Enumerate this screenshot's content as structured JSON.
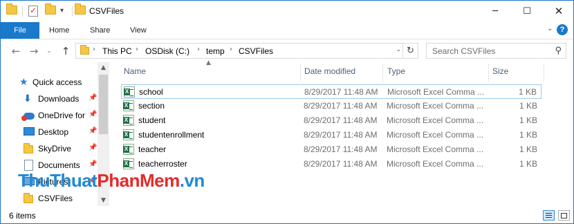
{
  "window": {
    "title": "CSVFiles"
  },
  "ribbon": {
    "tabs": [
      "File",
      "Home",
      "Share",
      "View"
    ]
  },
  "address": {
    "crumbs": [
      "This PC",
      "OSDisk (C:)",
      "temp",
      "CSVFiles"
    ]
  },
  "search": {
    "placeholder": "Search CSVFiles"
  },
  "nav": {
    "items": [
      {
        "label": "Quick access",
        "icon": "star-icon"
      },
      {
        "label": "Downloads",
        "icon": "download-icon",
        "pinned": true
      },
      {
        "label": "OneDrive for",
        "icon": "onedrive-icon",
        "pinned": true
      },
      {
        "label": "Desktop",
        "icon": "desktop-icon",
        "pinned": true
      },
      {
        "label": "SkyDrive",
        "icon": "folder-icon",
        "pinned": true
      },
      {
        "label": "Documents",
        "icon": "documents-icon",
        "pinned": true
      },
      {
        "label": "Pictures",
        "icon": "pictures-icon",
        "pinned": true
      },
      {
        "label": "CSVFiles",
        "icon": "folder-icon"
      }
    ]
  },
  "columns": {
    "name": "Name",
    "date": "Date modified",
    "type": "Type",
    "size": "Size"
  },
  "files": [
    {
      "name": "school",
      "date": "8/29/2017 11:48 AM",
      "type": "Microsoft Excel Comma ...",
      "size": "1 KB"
    },
    {
      "name": "section",
      "date": "8/29/2017 11:48 AM",
      "type": "Microsoft Excel Comma ...",
      "size": "1 KB"
    },
    {
      "name": "student",
      "date": "8/29/2017 11:48 AM",
      "type": "Microsoft Excel Comma ...",
      "size": "1 KB"
    },
    {
      "name": "studentenrollment",
      "date": "8/29/2017 11:48 AM",
      "type": "Microsoft Excel Comma ...",
      "size": "1 KB"
    },
    {
      "name": "teacher",
      "date": "8/29/2017 11:48 AM",
      "type": "Microsoft Excel Comma ...",
      "size": "1 KB"
    },
    {
      "name": "teacherroster",
      "date": "8/29/2017 11:48 AM",
      "type": "Microsoft Excel Comma ...",
      "size": "1 KB"
    }
  ],
  "status": {
    "item_count": "6 items"
  },
  "watermark": {
    "part1": "ThuThuat",
    "part2": "PhanMem",
    "part3": ".vn"
  },
  "colors": {
    "accent": "#1979ca",
    "selection_border": "#99c9ef",
    "excel_green": "#1e7145"
  }
}
